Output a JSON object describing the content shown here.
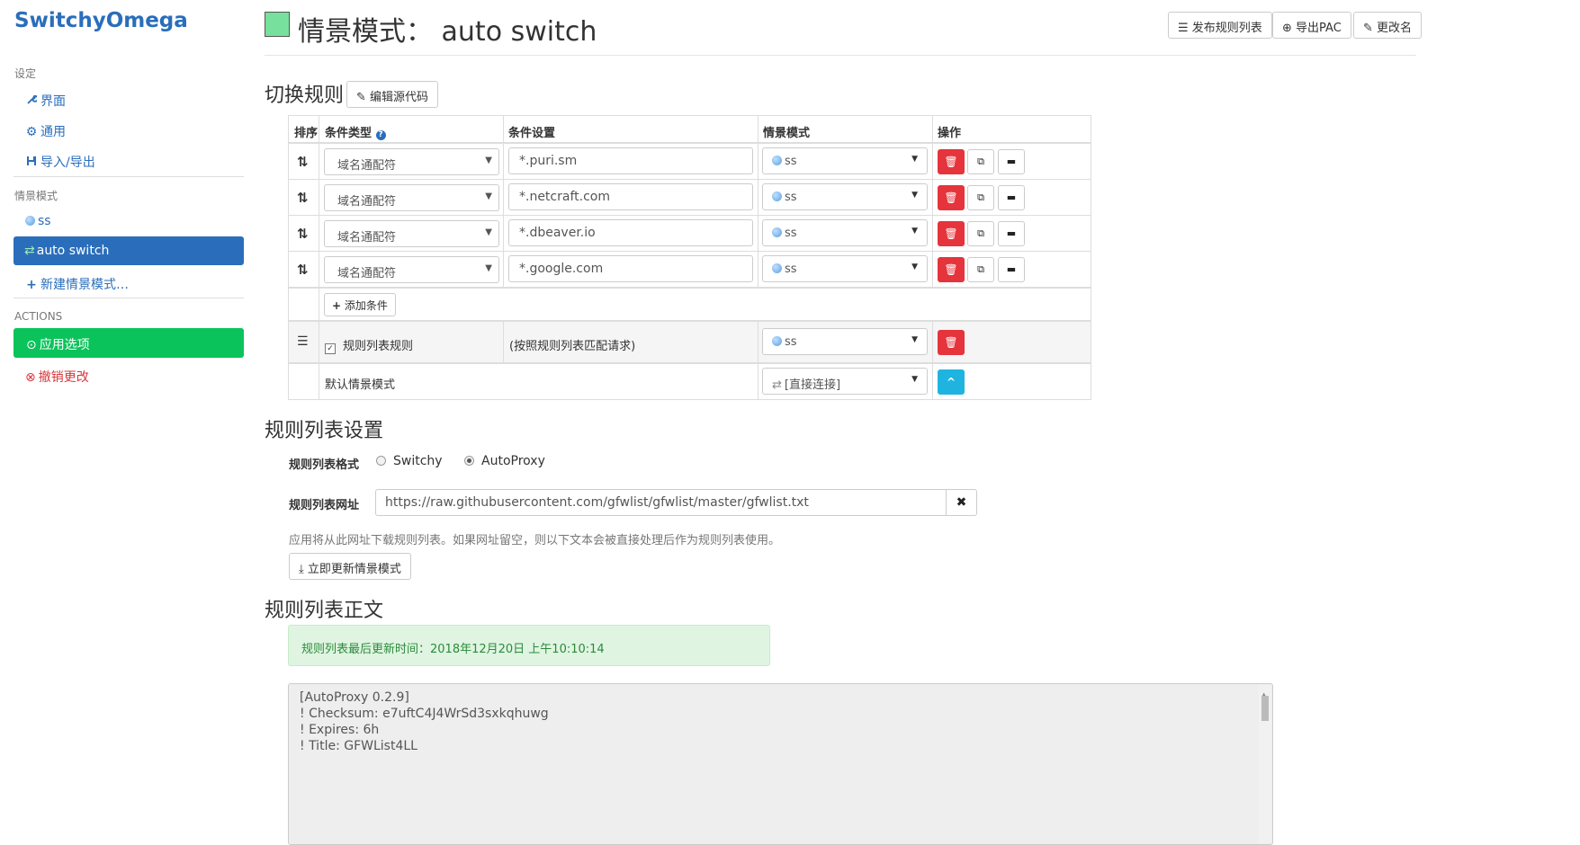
{
  "app": {
    "brand": "SwitchyOmega"
  },
  "sidebar": {
    "settings_header": "设定",
    "settings_items": [
      {
        "icon": "wrench-icon",
        "glyph": "🔧",
        "label": "界面"
      },
      {
        "icon": "gear-icon",
        "glyph": "⚙",
        "label": "通用"
      },
      {
        "icon": "import-export-icon",
        "glyph": "⇅",
        "label": "导入/导出"
      }
    ],
    "profiles_header": "情景模式",
    "profile_ss": "ss",
    "profile_active": "auto switch",
    "new_profile": "新建情景模式…",
    "actions_header": "ACTIONS",
    "apply": "应用选项",
    "discard": "撤销更改"
  },
  "header": {
    "title": "情景模式： auto switch",
    "swatch_color": "#77e09d",
    "publish": "发布规则列表",
    "export_pac": "导出PAC",
    "rename": "更改名"
  },
  "switch_rules": {
    "section_title": "切换规则",
    "edit_source": "编辑源代码",
    "columns": {
      "sort": "排序",
      "type": "条件类型",
      "setting": "条件设置",
      "profile": "情景模式",
      "ops": "操作"
    },
    "rows": [
      {
        "type": "域名通配符",
        "pattern": "*.puri.sm",
        "profile": "ss"
      },
      {
        "type": "域名通配符",
        "pattern": "*.netcraft.com",
        "profile": "ss"
      },
      {
        "type": "域名通配符",
        "pattern": "*.dbeaver.io",
        "profile": "ss"
      },
      {
        "type": "域名通配符",
        "pattern": "*.google.com",
        "profile": "ss"
      }
    ],
    "add_condition": "添加条件",
    "rulelist_label": "规则列表规则",
    "rulelist_desc": "(按照规则列表匹配请求)",
    "rulelist_profile": "ss",
    "default_label": "默认情景模式",
    "default_profile": "[直接连接]"
  },
  "rulelist_settings": {
    "section_title": "规则列表设置",
    "format_label": "规则列表格式",
    "format_options": [
      "Switchy",
      "AutoProxy"
    ],
    "format_selected": "AutoProxy",
    "url_label": "规则列表网址",
    "url_value": "https://raw.githubusercontent.com/gfwlist/gfwlist/master/gfwlist.txt",
    "help": "应用将从此网址下载规则列表。如果网址留空，则以下文本会被直接处理后作为规则列表使用。",
    "update_now": "立即更新情景模式"
  },
  "rulelist_text": {
    "section_title": "规则列表正文",
    "last_updated": "规则列表最后更新时间：2018年12月20日 上午10:10:14",
    "lines": [
      "[AutoProxy 0.2.9]",
      "! Checksum: e7uftC4J4WrSd3sxkqhuwg",
      "! Expires: 6h",
      "! Title: GFWList4LL"
    ]
  }
}
